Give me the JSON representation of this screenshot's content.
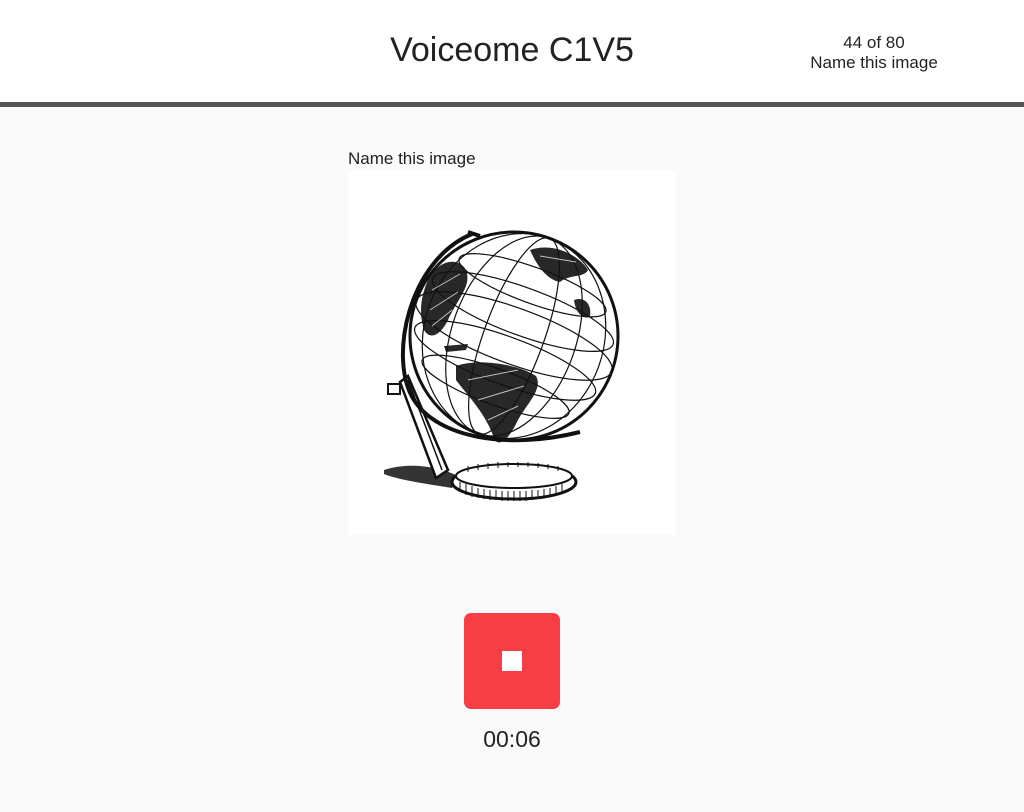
{
  "header": {
    "title": "Voiceome C1V5",
    "progress_text": "44 of 80",
    "task_name": "Name this image"
  },
  "prompt": {
    "label": "Name this image",
    "image_icon": "globe-illustration"
  },
  "recorder": {
    "stop_icon": "stop-icon",
    "button_color": "#f83e45",
    "elapsed": "00:06"
  }
}
